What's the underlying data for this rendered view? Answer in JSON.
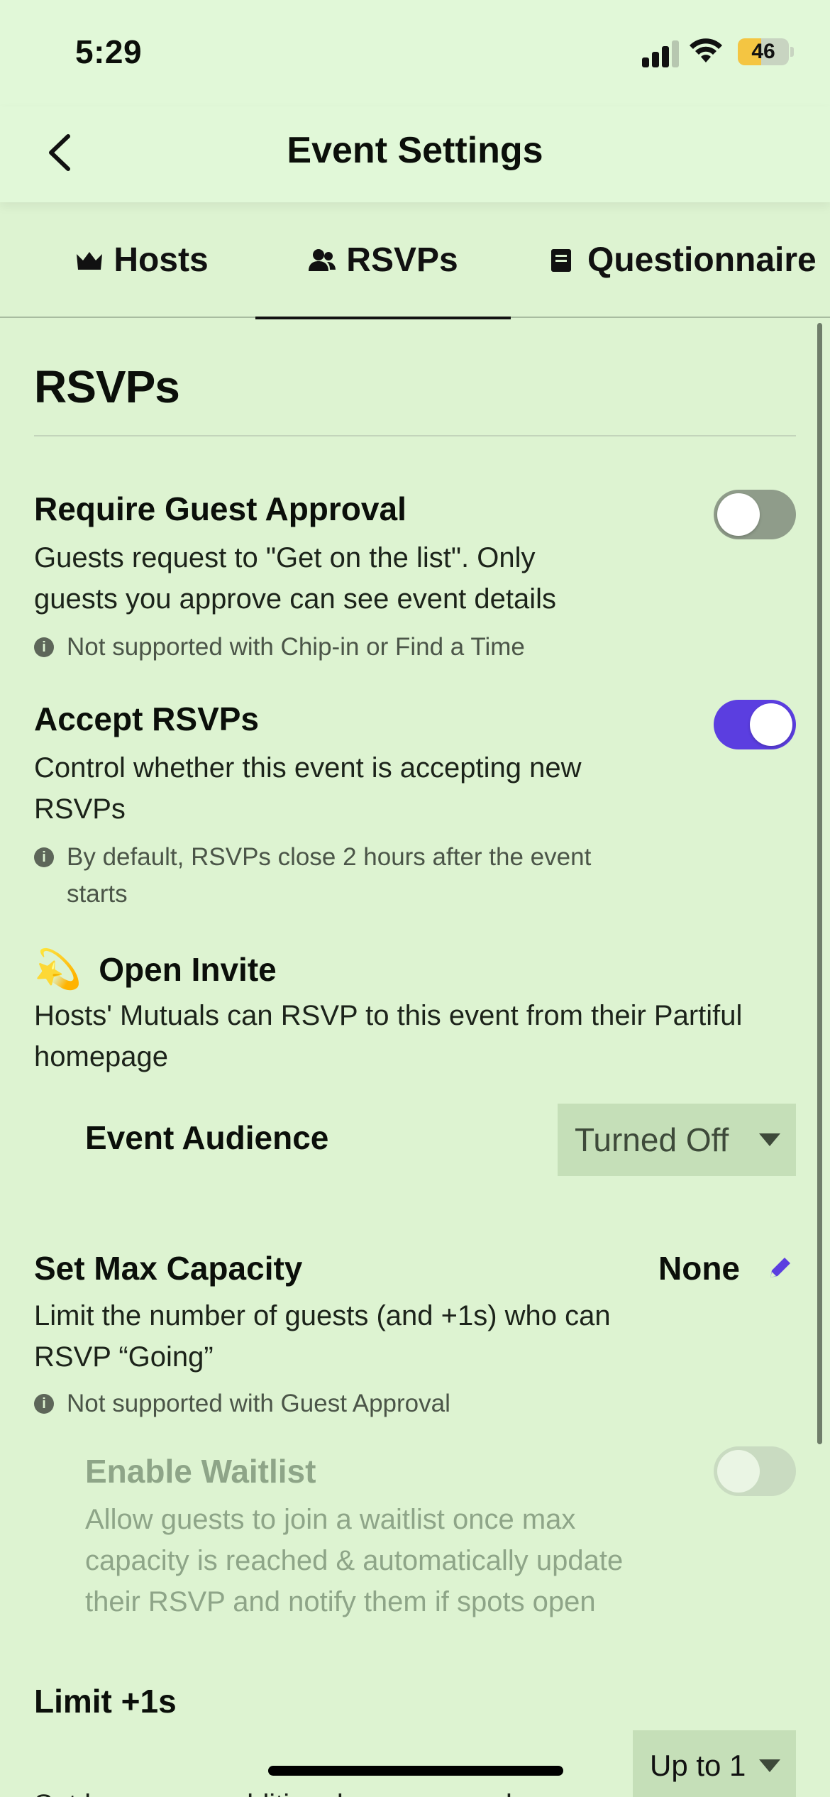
{
  "status_bar": {
    "time": "5:29",
    "battery_level": "46"
  },
  "nav": {
    "title": "Event Settings",
    "back_icon": "chevron-left-icon"
  },
  "tabs": [
    {
      "label": "Hosts",
      "icon": "crown-icon",
      "active": false
    },
    {
      "label": "RSVPs",
      "icon": "people-icon",
      "active": true
    },
    {
      "label": "Questionnaire",
      "icon": "document-icon",
      "active": false
    }
  ],
  "section": {
    "title": "RSVPs"
  },
  "settings": {
    "guest_approval": {
      "title": "Require Guest Approval",
      "description": "Guests request to \"Get on the list\". Only guests you approve can see event details",
      "note": "Not supported with Chip-in or Find a Time",
      "enabled": false
    },
    "accept_rsvps": {
      "title": "Accept RSVPs",
      "description": "Control whether this event is accepting new RSVPs",
      "note": "By default, RSVPs close 2 hours after the event starts",
      "enabled": true
    },
    "open_invite": {
      "emoji": "💫",
      "title": "Open Invite",
      "description": "Hosts' Mutuals can RSVP to this event from their Partiful homepage",
      "audience_label": "Event Audience",
      "audience_value": "Turned Off"
    },
    "max_capacity": {
      "title": "Set Max Capacity",
      "value": "None",
      "description": "Limit the number of guests (and +1s) who can RSVP “Going”",
      "note": "Not supported with Guest Approval"
    },
    "waitlist": {
      "title": "Enable Waitlist",
      "description": "Allow guests to join a waitlist once max capacity is reached & automatically update their RSVP and notify them if spots open",
      "enabled": false,
      "disabled": true
    },
    "limit_plus_ones": {
      "title": "Limit +1s",
      "value": "Up to 1",
      "description": "Set how many additional persons each"
    }
  },
  "colors": {
    "accent": "#5b3ee0",
    "background": "#ddf3d1",
    "header": "#e1f8d8"
  }
}
